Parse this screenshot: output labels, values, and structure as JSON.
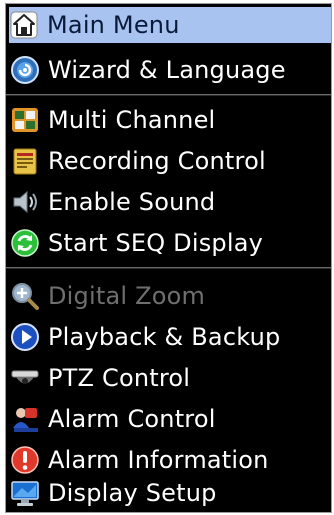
{
  "menu": {
    "items": [
      {
        "name": "main-menu",
        "label": "Main Menu",
        "icon": "home-icon",
        "selected": true
      },
      {
        "name": "wizard-language",
        "label": "Wizard & Language",
        "icon": "wizard-icon"
      },
      {
        "name": "multi-channel",
        "label": "Multi Channel",
        "icon": "multi-channel-icon"
      },
      {
        "name": "recording-control",
        "label": "Recording Control",
        "icon": "recording-icon"
      },
      {
        "name": "enable-sound",
        "label": "Enable Sound",
        "icon": "speaker-icon"
      },
      {
        "name": "start-seq-display",
        "label": "Start SEQ Display",
        "icon": "refresh-icon"
      },
      {
        "name": "digital-zoom",
        "label": "Digital Zoom",
        "icon": "zoom-icon",
        "disabled": true
      },
      {
        "name": "playback-backup",
        "label": "Playback & Backup",
        "icon": "play-icon"
      },
      {
        "name": "ptz-control",
        "label": "PTZ Control",
        "icon": "dome-camera-icon"
      },
      {
        "name": "alarm-control",
        "label": "Alarm Control",
        "icon": "alarm-icon"
      },
      {
        "name": "alarm-information",
        "label": "Alarm Information",
        "icon": "alert-icon"
      },
      {
        "name": "display-setup",
        "label": "Display Setup",
        "icon": "monitor-icon"
      }
    ]
  },
  "colors": {
    "background": "#000000",
    "highlight": "#a8c3f0",
    "text": "#ffffff",
    "disabled_text": "#6f6f6f"
  }
}
